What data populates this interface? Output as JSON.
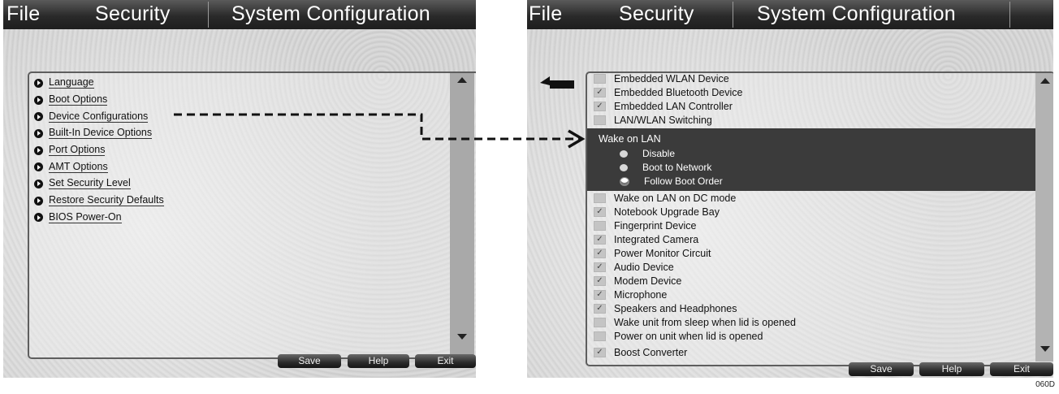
{
  "menubar": {
    "file": "File",
    "security": "Security",
    "system_configuration": "System Configuration"
  },
  "left_menu": [
    {
      "label": "Language"
    },
    {
      "label": "Boot Options"
    },
    {
      "label": "Device Configurations"
    },
    {
      "label": "Built-In Device Options"
    },
    {
      "label": "Port Options"
    },
    {
      "label": "AMT Options"
    },
    {
      "label": "Set Security Level"
    },
    {
      "label": "Restore Security Defaults"
    },
    {
      "label": "BIOS Power-On"
    }
  ],
  "buttons": {
    "save": "Save",
    "help": "Help",
    "exit": "Exit"
  },
  "device_options": {
    "top_items": [
      {
        "label": "Embedded WLAN Device",
        "checked": false
      },
      {
        "label": "Embedded Bluetooth Device",
        "checked": true
      },
      {
        "label": "Embedded LAN Controller",
        "checked": true
      },
      {
        "label": "LAN/WLAN Switching",
        "checked": false
      }
    ],
    "wake_on_lan": {
      "title": "Wake on LAN",
      "options": [
        {
          "label": "Disable",
          "selected": false
        },
        {
          "label": "Boot to Network",
          "selected": false
        },
        {
          "label": "Follow Boot Order",
          "selected": true
        }
      ]
    },
    "bottom_items": [
      {
        "label": "Wake on LAN on DC mode",
        "checked": false
      },
      {
        "label": "Notebook Upgrade Bay",
        "checked": true
      },
      {
        "label": "Fingerprint Device",
        "checked": false
      },
      {
        "label": "Integrated Camera",
        "checked": true
      },
      {
        "label": "Power Monitor Circuit",
        "checked": true
      },
      {
        "label": "Audio Device",
        "checked": true
      },
      {
        "label": "Modem Device",
        "checked": true
      },
      {
        "label": "Microphone",
        "checked": true
      },
      {
        "label": "Speakers and Headphones",
        "checked": true
      },
      {
        "label": "Wake unit from sleep when lid is opened",
        "checked": false
      },
      {
        "label": "Power on unit when lid is opened",
        "checked": false
      },
      {
        "label": "Boost Converter",
        "checked": true
      }
    ]
  },
  "figure_code": "060D"
}
